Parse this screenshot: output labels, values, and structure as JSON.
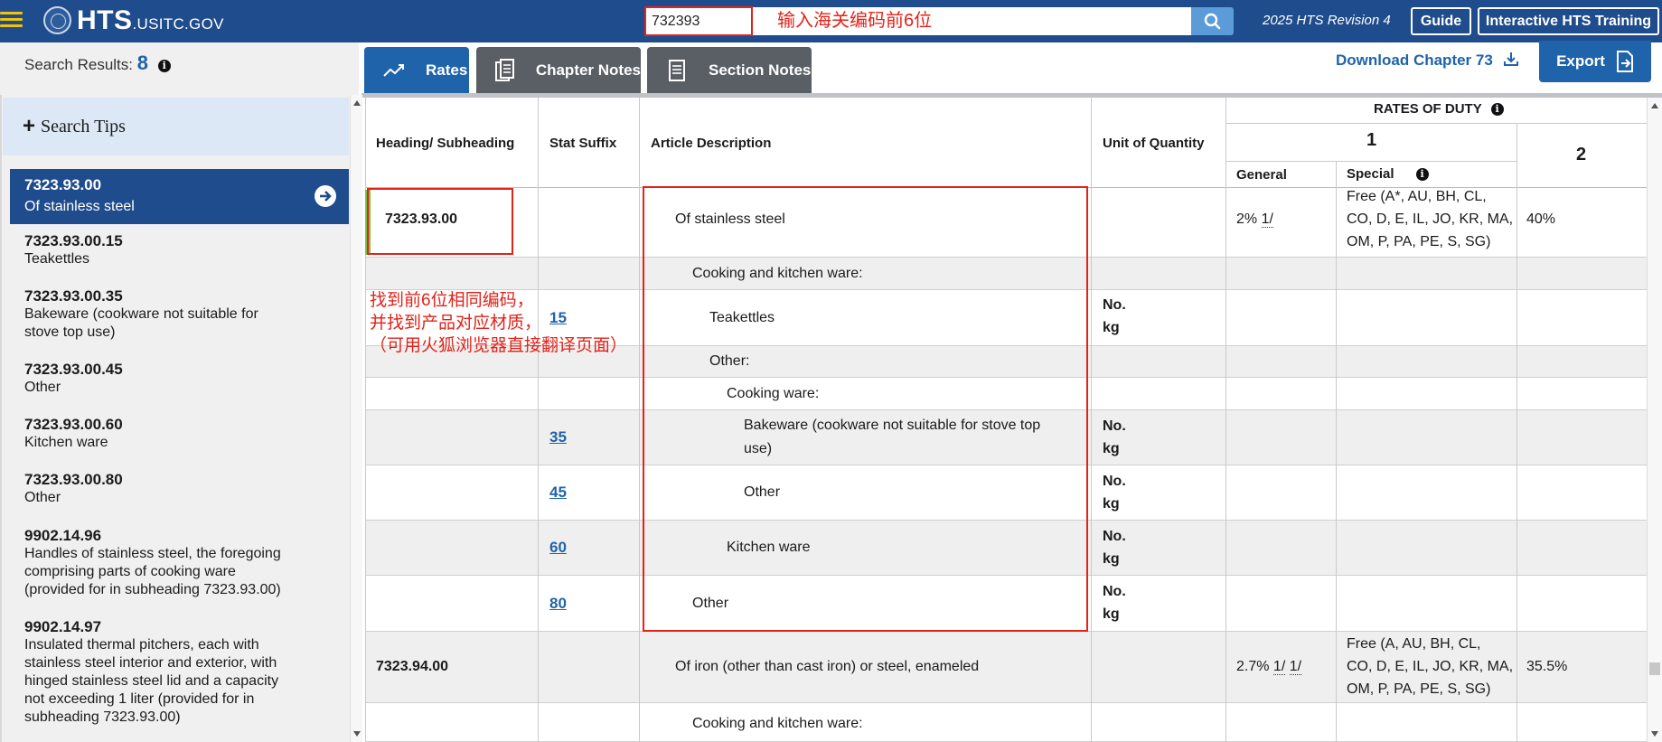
{
  "header": {
    "logo_main": "HTS",
    "logo_domain": ".USITC.GOV",
    "search_value": "732393",
    "revision": "2025 HTS Revision 4",
    "guide_label": "Guide",
    "training_label": "Interactive HTS Training"
  },
  "annotations": {
    "search_note": "输入海关编码前6位",
    "find_line1": "找到前6位相同编码，",
    "find_line2": "并找到产品对应材质，",
    "find_line3": "（可用火狐浏览器直接翻译页面）"
  },
  "results": {
    "label": "Search Results:",
    "count": "8"
  },
  "tabs": {
    "rates": "Rates",
    "chapter_notes": "Chapter Notes",
    "section_notes": "Section Notes"
  },
  "toolbar": {
    "download": "Download Chapter 73",
    "export": "Export"
  },
  "sidebar": {
    "tips": "Search Tips",
    "items": [
      {
        "code": "7323.93.00",
        "desc": "Of stainless steel"
      },
      {
        "code": "7323.93.00.15",
        "desc": "Teakettles"
      },
      {
        "code": "7323.93.00.35",
        "desc": "Bakeware (cookware not suitable for",
        "desc2": "stove top use)"
      },
      {
        "code": "7323.93.00.45",
        "desc": "Other"
      },
      {
        "code": "7323.93.00.60",
        "desc": "Kitchen ware"
      },
      {
        "code": "7323.93.00.80",
        "desc": "Other"
      },
      {
        "code": "9902.14.96",
        "desc": "Handles of stainless steel, the foregoing",
        "desc2": "comprising parts of cooking ware",
        "desc3": "(provided for in subheading 7323.93.00)"
      },
      {
        "code": "9902.14.97",
        "desc": "Insulated thermal pitchers, each with",
        "desc2": "stainless steel interior and exterior, with",
        "desc3": "hinged stainless steel lid and a capacity",
        "desc4": "not exceeding 1 liter (provided for in",
        "desc5": "subheading 7323.93.00)"
      }
    ]
  },
  "table": {
    "headers": {
      "heading": "Heading/ Subheading",
      "stat": "Stat Suffix",
      "desc": "Article Description",
      "unit": "Unit of Quantity",
      "rates": "RATES OF DUTY",
      "col1": "1",
      "col2": "2",
      "general": "General",
      "special": "Special"
    },
    "rows": {
      "r1_heading": "7323.93.00",
      "r1_desc": "Of stainless steel",
      "r1_general": "2%",
      "r1_general_note": "1/",
      "r1_special1": "Free (A*, AU, BH, CL,",
      "r1_special2": "CO, D, E, IL, JO, KR, MA,",
      "r1_special3": "OM, P, PA, PE, S, SG)",
      "r1_col2": "40%",
      "r2_desc": "Cooking and kitchen ware:",
      "r3_stat": "15",
      "r3_desc": "Teakettles",
      "r3_unit1": "No.",
      "r3_unit2": "kg",
      "r4_desc": "Other:",
      "r5_desc": "Cooking ware:",
      "r6_stat": "35",
      "r6_desc1": "Bakeware (cookware not suitable for stove top",
      "r6_desc2": "use)",
      "r6_unit1": "No.",
      "r6_unit2": "kg",
      "r7_stat": "45",
      "r7_desc": "Other",
      "r7_unit1": "No.",
      "r7_unit2": "kg",
      "r8_stat": "60",
      "r8_desc": "Kitchen ware",
      "r8_unit1": "No.",
      "r8_unit2": "kg",
      "r9_stat": "80",
      "r9_desc": "Other",
      "r9_unit1": "No.",
      "r9_unit2": "kg",
      "r10_heading": "7323.94.00",
      "r10_desc": "Of iron (other than cast iron) or steel, enameled",
      "r10_general": "2.7%",
      "r10_general_note1": "1/",
      "r10_general_note2": "1/",
      "r10_special1": "Free (A, AU, BH, CL,",
      "r10_special2": "CO, D, E, IL, JO, KR, MA,",
      "r10_special3": "OM, P, PA, PE, S, SG)",
      "r10_col2": "35.5%",
      "r11_desc": "Cooking and kitchen ware:"
    }
  }
}
